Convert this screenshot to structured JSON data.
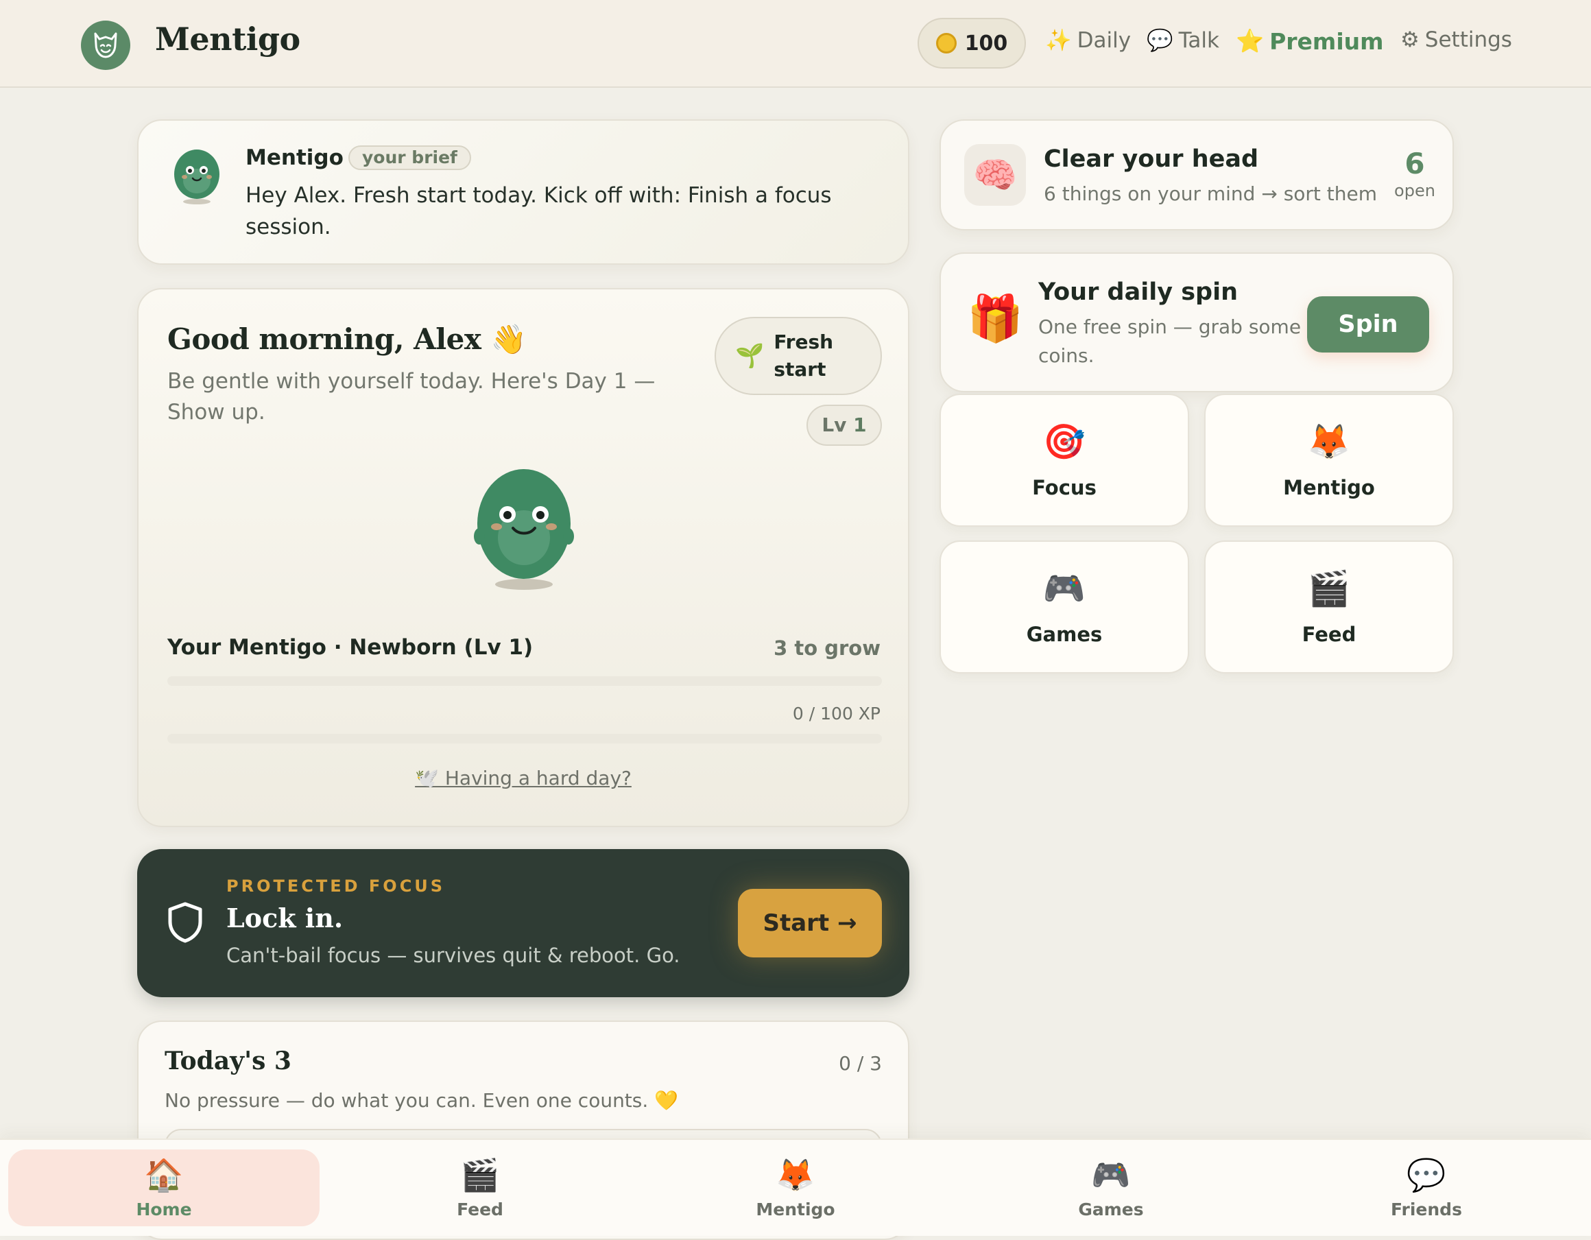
{
  "header": {
    "brand": "Mentigo",
    "coins": "100",
    "nav": [
      {
        "label": "Daily",
        "icon": "sparkles-icon"
      },
      {
        "label": "Talk",
        "icon": "speech-bubble-icon"
      },
      {
        "label": "Premium",
        "icon": "star-icon"
      },
      {
        "label": "Settings",
        "icon": "gear-icon"
      }
    ]
  },
  "brief": {
    "name": "Mentigo",
    "tag": "your brief",
    "message": "Hey Alex. Fresh start today. Kick off with: Finish a focus session."
  },
  "hero": {
    "greeting": "Good morning, Alex 👋",
    "subtitle": "Be gentle with yourself today. Here's Day 1 — Show up.",
    "badge": "Fresh start",
    "level_badge_prefix": "Lv",
    "level_badge_value": "1",
    "mentigo_status": "Your Mentigo · Newborn (Lv 1)",
    "to_grow": "3 to grow",
    "grow_progress": 0,
    "xp_text": "0 / 100 XP",
    "xp_progress": 0,
    "hard_day": "🕊️ Having a hard day?"
  },
  "focus": {
    "eyebrow": "PROTECTED FOCUS",
    "title": "Lock in.",
    "description": "Can't-bail focus — survives quit & reboot. Go.",
    "button": "Start →"
  },
  "today": {
    "title": "Today's 3",
    "count": "0 / 3",
    "note": "No pressure — do what you can. Even one counts. 💛"
  },
  "clear_head": {
    "title": "Clear your head",
    "subtitle": "6 things on your mind → sort them",
    "count": "6",
    "count_label": "open"
  },
  "spin": {
    "title": "Your daily spin",
    "subtitle": "One free spin — grab some coins.",
    "button": "Spin"
  },
  "tiles": [
    {
      "label": "Focus",
      "emoji": "🎯"
    },
    {
      "label": "Mentigo",
      "emoji": "🦊"
    },
    {
      "label": "Games",
      "emoji": "🎮"
    },
    {
      "label": "Feed",
      "emoji": "🎬"
    }
  ],
  "tabbar": [
    {
      "label": "Home",
      "emoji": "🏠",
      "active": true
    },
    {
      "label": "Feed",
      "emoji": "🎬"
    },
    {
      "label": "Mentigo",
      "emoji": "🦊"
    },
    {
      "label": "Games",
      "emoji": "🎮"
    },
    {
      "label": "Friends",
      "emoji": "💬"
    }
  ],
  "colors": {
    "accent": "#5d8b66",
    "focus_bg": "#2f3c34",
    "start_button": "#d8a240",
    "active_tab": "#fbe4dc"
  }
}
